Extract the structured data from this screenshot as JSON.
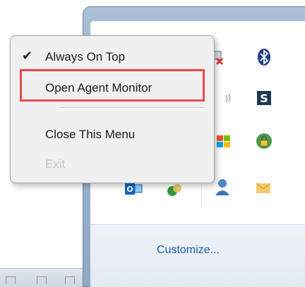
{
  "context_menu": {
    "items": [
      {
        "label": "Always On Top",
        "checked": true,
        "check_glyph": "✔"
      },
      {
        "label": "Open Agent Monitor",
        "highlighted": true
      },
      {
        "label": "Close This Menu"
      },
      {
        "label": "Exit",
        "disabled": true
      }
    ]
  },
  "tray": {
    "customize_label": "Customize...",
    "icons": [
      "network-error-icon",
      "bluetooth-icon",
      "volume-icon",
      "s-app-icon",
      "windows-flag-icon",
      "lock-icon",
      "outlook-icon",
      "chat-status-icon",
      "agent-user-icon",
      "mail-envelope-icon"
    ]
  },
  "colors": {
    "highlight_border": "#e8484f",
    "link": "#1f5ea8",
    "menu_bg": "#f0f0f0",
    "window_frame": "#a9c0d8"
  }
}
